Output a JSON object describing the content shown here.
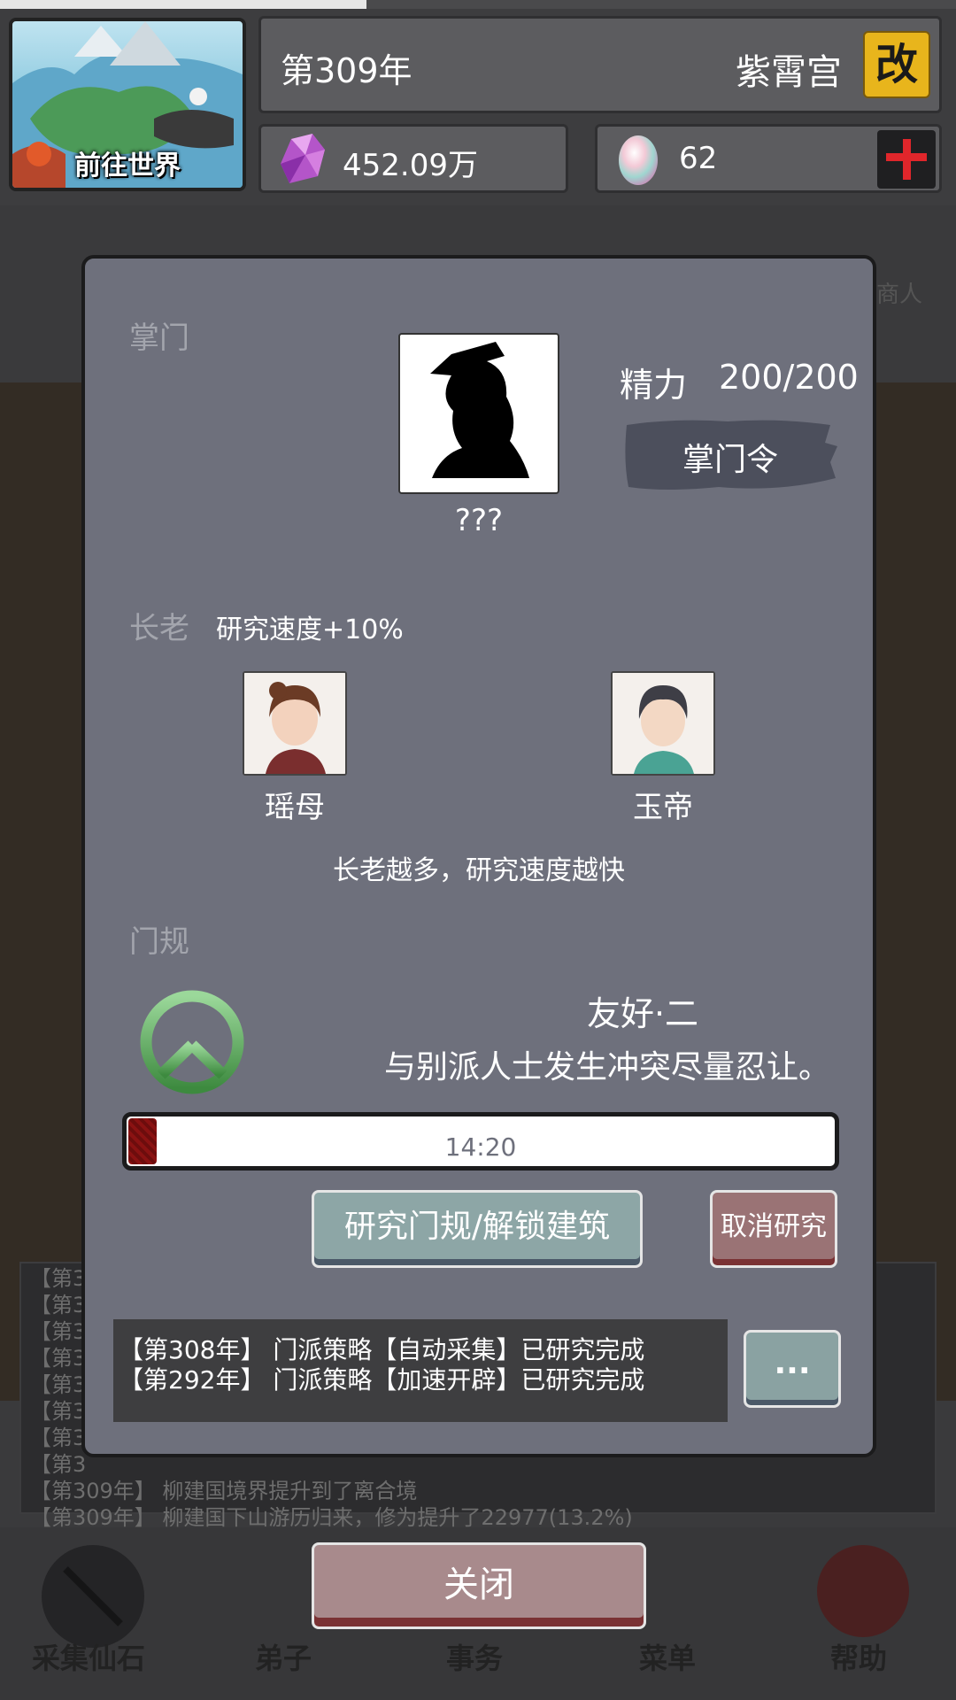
{
  "topbar": {
    "world_label": "前往世界",
    "year": "第309年",
    "sect_name": "紫霄宫",
    "rename_label": "改",
    "spirit_stones": "452.09万",
    "gems": "62"
  },
  "background": {
    "merchant_label": "商人",
    "log_lines": [
      "【第3",
      "【第3",
      "【第3",
      "【第3",
      "【第3",
      "【第3",
      "【第3",
      "【第3",
      "【第309年】 柳建国境界提升到了离合境",
      "【第309年】 柳建国下山游历归来，修为提升了22977(13.2%)"
    ],
    "nav": [
      "采集仙石",
      "弟子",
      "事务",
      "菜单",
      "帮助"
    ]
  },
  "modal": {
    "leader_section": "掌门",
    "leader_name": "???",
    "energy_label": "精力",
    "energy_value": "200/200",
    "leader_order": "掌门令",
    "elder_section": "长老",
    "elder_bonus": "研究速度+10%",
    "elders": [
      "瑶母",
      "玉帝"
    ],
    "elder_hint": "长老越多，研究速度越快",
    "rules_section": "门规",
    "rule_icon": "peace-icon",
    "rule_name": "友好·二",
    "rule_desc": "与别派人士发生冲突尽量忍让。",
    "progress_fraction": 0.04,
    "progress_time": "14:20",
    "research_button": "研究门规/解锁建筑",
    "cancel_button": "取消研究",
    "log": [
      "【第308年】 门派策略【自动采集】已研究完成",
      "【第292年】 门派策略【加速开辟】已研究完成"
    ],
    "more_button": "...",
    "close_button": "关闭"
  }
}
